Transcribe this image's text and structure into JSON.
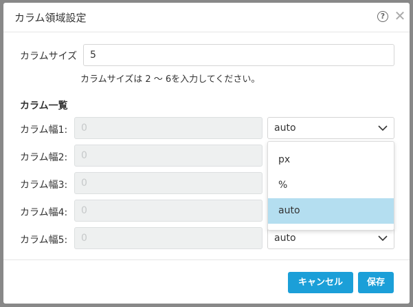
{
  "dialog": {
    "title": "カラム領域設定",
    "help_icon_glyph": "?",
    "close_icon_glyph": "✕"
  },
  "column_size": {
    "label": "カラムサイズ",
    "value": "5",
    "hint": "カラムサイズは 2 ～ 6を入力してください。"
  },
  "column_list": {
    "title": "カラム一覧",
    "rows": [
      {
        "label": "カラム幅1:",
        "width_placeholder": "0",
        "unit": "auto"
      },
      {
        "label": "カラム幅2:",
        "width_placeholder": "0",
        "unit": ""
      },
      {
        "label": "カラム幅3:",
        "width_placeholder": "0",
        "unit": ""
      },
      {
        "label": "カラム幅4:",
        "width_placeholder": "0",
        "unit": ""
      },
      {
        "label": "カラム幅5:",
        "width_placeholder": "0",
        "unit": "auto"
      }
    ]
  },
  "unit_dropdown": {
    "options": [
      "px",
      "%",
      "auto"
    ],
    "selected": "auto",
    "highlight_color": "#b4def0"
  },
  "buttons": {
    "cancel": "キャンセル",
    "save": "保存",
    "primary_color": "#1b9fd8"
  }
}
